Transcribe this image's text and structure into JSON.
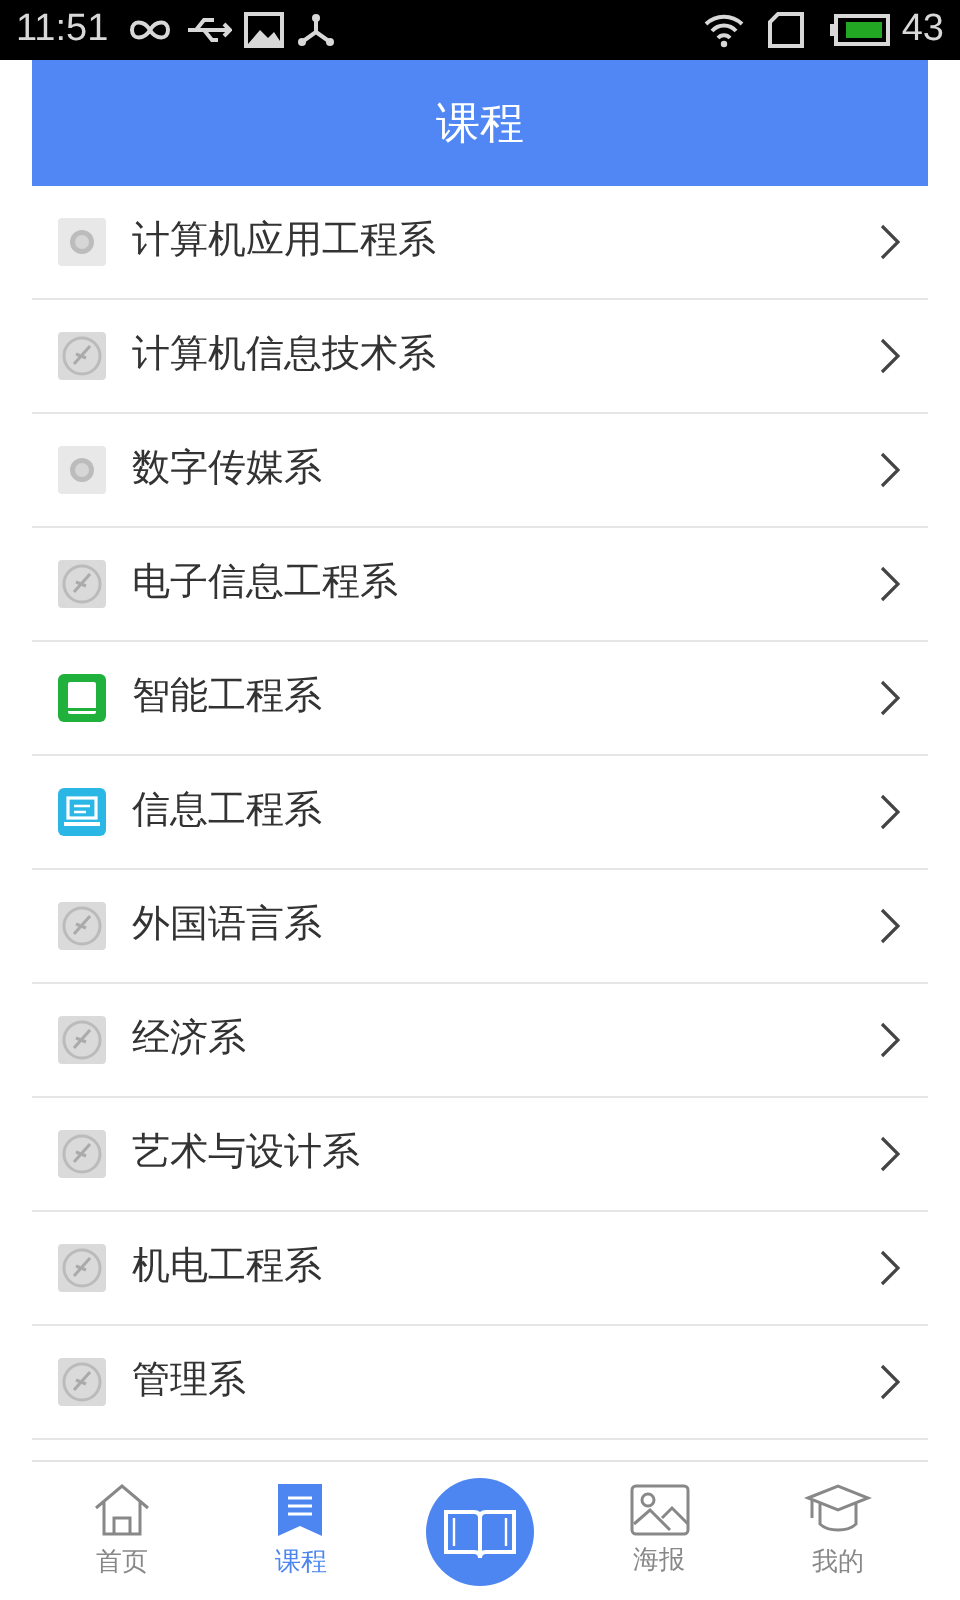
{
  "status_bar": {
    "time": "11:51",
    "battery": "43"
  },
  "header": {
    "title": "课程"
  },
  "departments": [
    {
      "name": "计算机应用工程系",
      "kind": "coin"
    },
    {
      "name": "计算机信息技术系",
      "kind": "seal"
    },
    {
      "name": "数字传媒系",
      "kind": "coin"
    },
    {
      "name": "电子信息工程系",
      "kind": "seal"
    },
    {
      "name": "智能工程系",
      "kind": "book"
    },
    {
      "name": "信息工程系",
      "kind": "laptop"
    },
    {
      "name": "外国语言系",
      "kind": "seal"
    },
    {
      "name": "经济系",
      "kind": "seal"
    },
    {
      "name": "艺术与设计系",
      "kind": "seal"
    },
    {
      "name": "机电工程系",
      "kind": "seal"
    },
    {
      "name": "管理系",
      "kind": "seal"
    }
  ],
  "tab_bar": [
    {
      "kind": "home",
      "label": "首页",
      "selected": false
    },
    {
      "kind": "list",
      "label": "课程",
      "selected": true
    },
    {
      "kind": "center"
    },
    {
      "kind": "poster",
      "label": "海报",
      "selected": false
    },
    {
      "kind": "profile",
      "label": "我的",
      "selected": false
    }
  ]
}
